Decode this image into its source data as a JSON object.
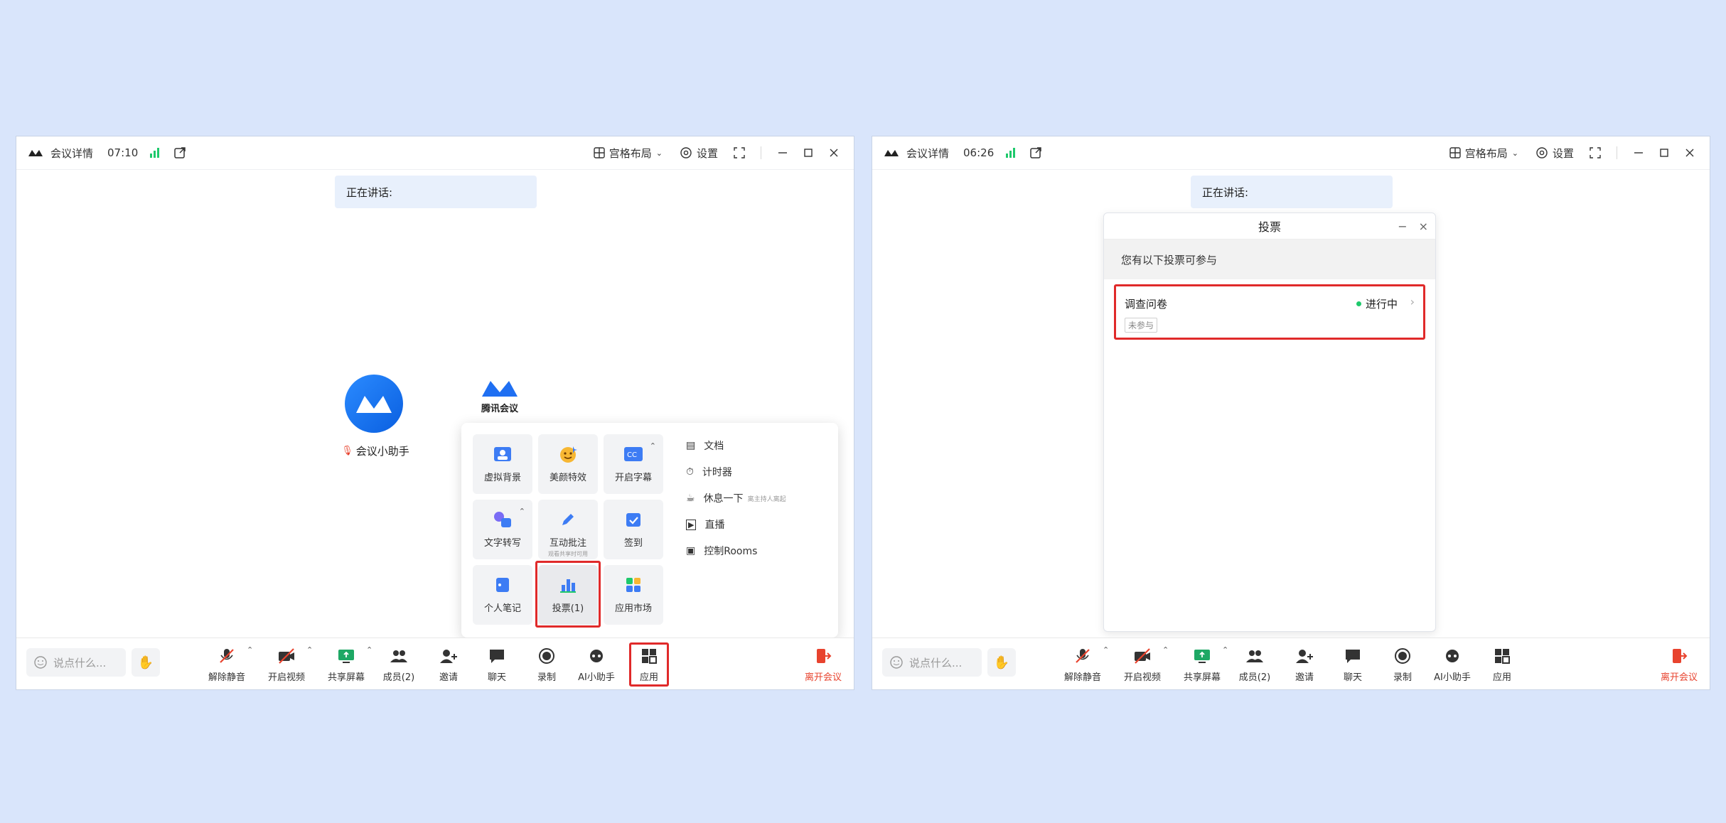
{
  "colors": {
    "background": "#d9e5fb",
    "accent": "#0a6cf5",
    "leave": "#e8432e",
    "highlight": "#e02a2a",
    "signal": "#1ec96c"
  },
  "left_window": {
    "title": "会议详情",
    "time": "07:10",
    "layout_label": "宫格布局",
    "settings_label": "设置",
    "speaking": "正在讲话:",
    "participant_name": "会议小助手",
    "tencent_label": "腾讯会议",
    "say_placeholder": "说点什么...",
    "toolbar": [
      "解除静音",
      "开启视频",
      "共享屏幕",
      "成员(2)",
      "邀请",
      "聊天",
      "录制",
      "AI小助手",
      "应用"
    ],
    "leave_label": "离开会议",
    "apps_tiles": [
      "虚拟背景",
      "美颜特效",
      "开启字幕",
      "文字转写",
      "互动批注",
      "签到",
      "个人笔记",
      "投票(1)",
      "应用市场"
    ],
    "annotate_sub": "观看共享时可用",
    "apps_side": [
      "文档",
      "计时器",
      "休息一下",
      "直播",
      "控制Rooms"
    ],
    "break_hint": "离主持人离起"
  },
  "right_window": {
    "title": "会议详情",
    "time": "06:26",
    "layout_label": "宫格布局",
    "settings_label": "设置",
    "speaking": "正在讲话:",
    "say_placeholder": "说点什么...",
    "toolbar": [
      "解除静音",
      "开启视频",
      "共享屏幕",
      "成员(2)",
      "邀请",
      "聊天",
      "录制",
      "AI小助手",
      "应用"
    ],
    "leave_label": "离开会议",
    "vote": {
      "title": "投票",
      "banner": "您有以下投票可参与",
      "item_title": "调查问卷",
      "item_status": "进行中",
      "item_badge": "未参与"
    }
  }
}
